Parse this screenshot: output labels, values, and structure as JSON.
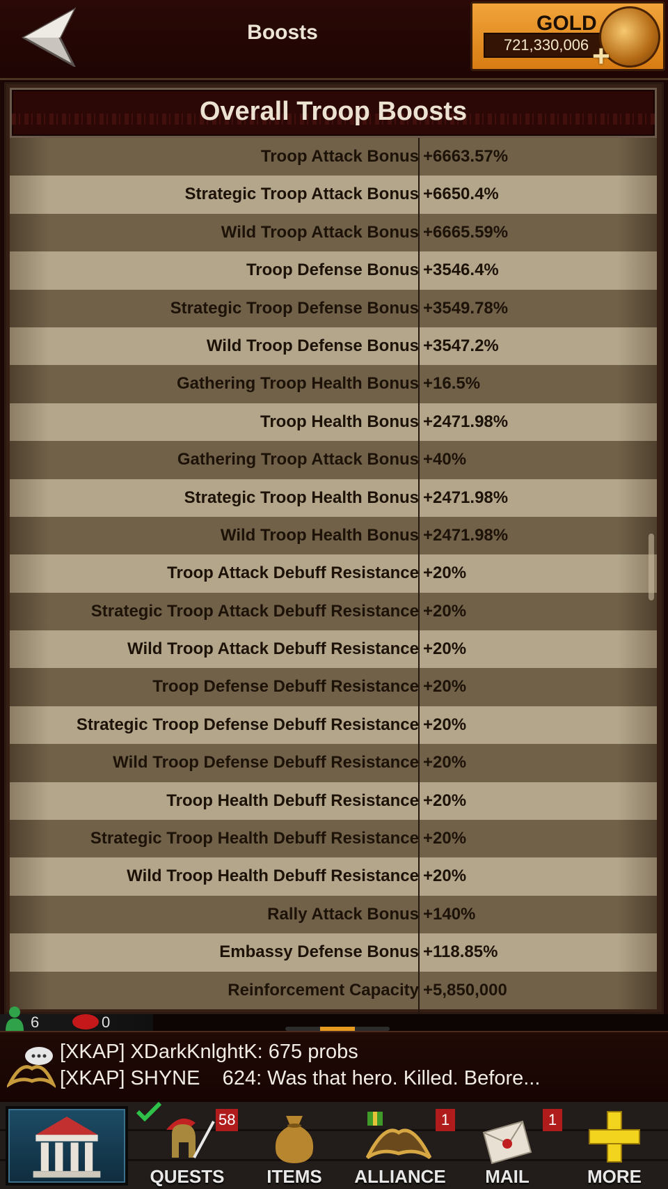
{
  "header": {
    "title": "Boosts",
    "gold_label": "GOLD",
    "gold_amount": "721,330,006"
  },
  "panel": {
    "title": "Overall Troop Boosts",
    "rows": [
      {
        "label": "Troop Attack Bonus",
        "value": "+6663.57%"
      },
      {
        "label": "Strategic Troop Attack Bonus",
        "value": "+6650.4%"
      },
      {
        "label": "Wild Troop Attack Bonus",
        "value": "+6665.59%"
      },
      {
        "label": "Troop Defense Bonus",
        "value": "+3546.4%"
      },
      {
        "label": "Strategic Troop Defense Bonus",
        "value": "+3549.78%"
      },
      {
        "label": "Wild Troop Defense Bonus",
        "value": "+3547.2%"
      },
      {
        "label": "Gathering Troop Health Bonus",
        "value": "+16.5%"
      },
      {
        "label": "Troop Health Bonus",
        "value": "+2471.98%"
      },
      {
        "label": "Gathering Troop Attack Bonus",
        "value": "+40%"
      },
      {
        "label": "Strategic Troop Health Bonus",
        "value": "+2471.98%"
      },
      {
        "label": "Wild Troop Health Bonus",
        "value": "+2471.98%"
      },
      {
        "label": "Troop Attack Debuff Resistance",
        "value": "+20%"
      },
      {
        "label": "Strategic Troop Attack Debuff Resistance",
        "value": "+20%"
      },
      {
        "label": "Wild Troop Attack Debuff Resistance",
        "value": "+20%"
      },
      {
        "label": "Troop Defense Debuff Resistance",
        "value": "+20%"
      },
      {
        "label": "Strategic Troop Defense Debuff Resistance",
        "value": "+20%"
      },
      {
        "label": "Wild Troop Defense Debuff Resistance",
        "value": "+20%"
      },
      {
        "label": "Troop Health Debuff Resistance",
        "value": "+20%"
      },
      {
        "label": "Strategic Troop Health Debuff Resistance",
        "value": "+20%"
      },
      {
        "label": "Wild Troop Health Debuff Resistance",
        "value": "+20%"
      },
      {
        "label": "Rally Attack Bonus",
        "value": "+140%"
      },
      {
        "label": "Embassy Defense Bonus",
        "value": "+118.85%"
      },
      {
        "label": "Reinforcement Capacity",
        "value": "+5,850,000"
      }
    ]
  },
  "status": {
    "players_online": "6",
    "unread_messages": "0"
  },
  "chat": {
    "line1": "[XKAP] XDarkKnlghtK: 675 probs",
    "line2": "[XKAP] SHYNE    624: Was that hero. Killed. Before..."
  },
  "nav": {
    "home_icon": "castle-icon",
    "quests": {
      "label": "QUESTS",
      "badge": "58",
      "icon": "spartan-helmet-quill-icon"
    },
    "items": {
      "label": "ITEMS",
      "icon": "gold-sack-icon"
    },
    "alliance": {
      "label": "ALLIANCE",
      "badge": "1",
      "icon": "alliance-helmet-icon"
    },
    "mail": {
      "label": "MAIL",
      "badge": "1",
      "icon": "envelope-icon"
    },
    "more": {
      "label": "MORE",
      "icon": "yellow-plus-icon"
    }
  },
  "colors": {
    "gold_accent": "#e58a1f",
    "badge_red": "#b01c1c",
    "row_dark": "#716149",
    "row_light": "#b3a68b"
  }
}
